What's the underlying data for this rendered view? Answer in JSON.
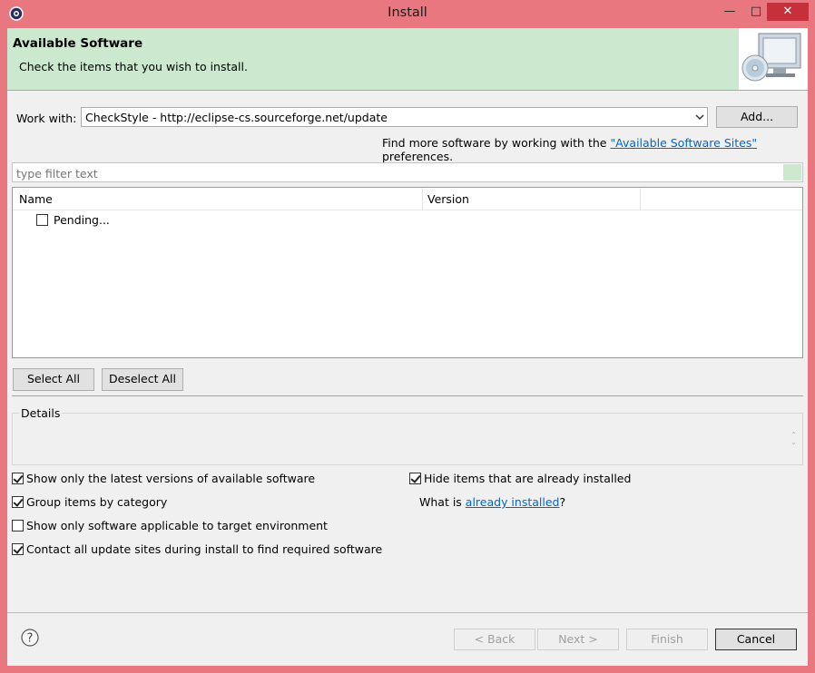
{
  "window": {
    "title": "Install"
  },
  "banner": {
    "title": "Available Software",
    "subtitle": "Check the items that you wish to install.",
    "image": "computer-with-cd-icon"
  },
  "work_with": {
    "label": "Work with:",
    "value": "CheckStyle - http://eclipse-cs.sourceforge.net/update",
    "add_button": "Add..."
  },
  "find_more": {
    "prefix": "Find more software by working with the ",
    "link": "\"Available Software Sites\"",
    "suffix": " preferences."
  },
  "filter": {
    "placeholder": "type filter text"
  },
  "tree": {
    "columns": [
      "Name",
      "Version"
    ],
    "items": [
      {
        "label": "Pending...",
        "checked": false
      }
    ]
  },
  "selection_buttons": {
    "select_all": "Select All",
    "deselect_all": "Deselect All"
  },
  "details": {
    "label": "Details"
  },
  "options": [
    {
      "label": "Show only the latest versions of available software",
      "checked": true
    },
    {
      "label": "Group items by category",
      "checked": true
    },
    {
      "label": "Show only software applicable to target environment",
      "checked": false
    },
    {
      "label": "Contact all update sites during install to find required software",
      "checked": true
    },
    {
      "label": "Hide items that are already installed",
      "checked": true
    }
  ],
  "what_is": {
    "prefix": "What is ",
    "link": "already installed",
    "suffix": "?"
  },
  "footer": {
    "back": "< Back",
    "next": "Next >",
    "finish": "Finish",
    "cancel": "Cancel"
  },
  "colors": {
    "titlebar": "#e8777f",
    "banner": "#cce8cf",
    "link": "#0066cc",
    "close": "#c7303a"
  }
}
